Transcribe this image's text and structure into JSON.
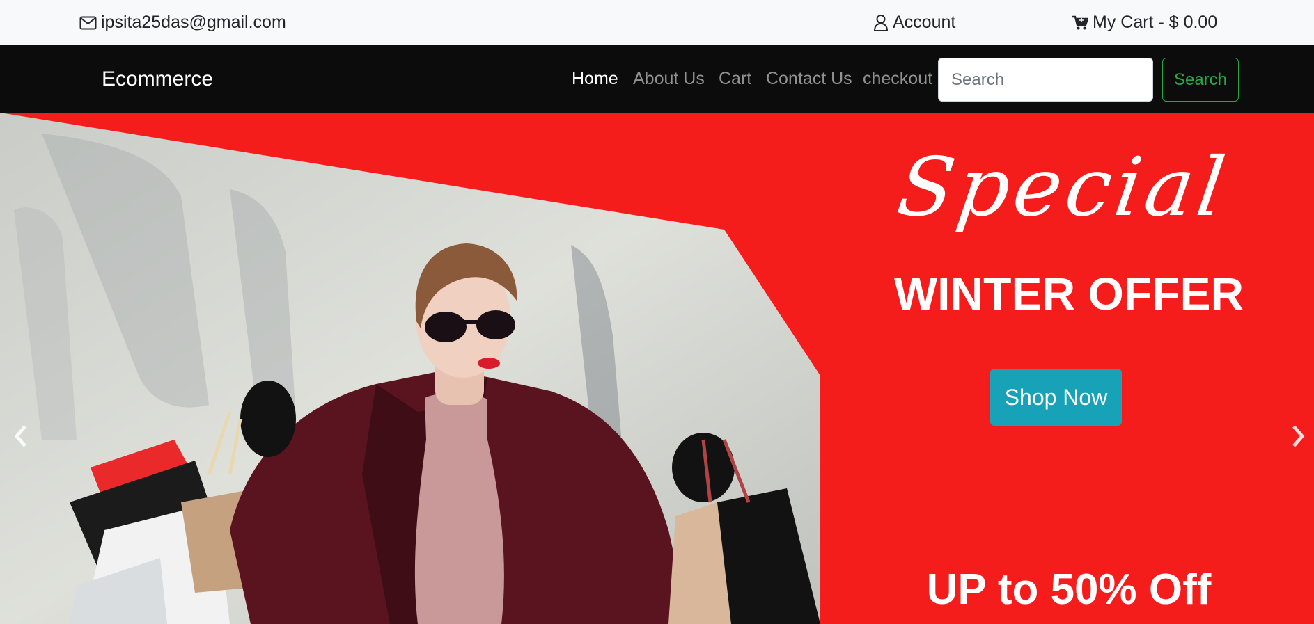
{
  "topbar": {
    "email": "ipsita25das@gmail.com",
    "account_label": "Account",
    "cart_label": "My Cart - $ 0.00",
    "icons": [
      "envelope-icon",
      "user-icon",
      "cart-icon"
    ]
  },
  "navbar": {
    "brand": "Ecommerce",
    "links": [
      {
        "label": "Home",
        "active": true
      },
      {
        "label": "About Us",
        "active": false
      },
      {
        "label": "Cart",
        "active": false
      },
      {
        "label": "Contact Us",
        "active": false
      },
      {
        "label": "checkout",
        "active": false
      }
    ],
    "search": {
      "placeholder": "Search",
      "value": "",
      "button_label": "Search"
    }
  },
  "hero": {
    "special": "Special",
    "headline": "WINTER OFFER",
    "cta_label": "Shop Now",
    "offer": "UP to 50% Off",
    "prev_icon": "chevron-left-icon",
    "next_icon": "chevron-right-icon"
  },
  "colors": {
    "topbar_bg": "#f8f9fa",
    "navbar_bg": "#0c0c0c",
    "hero_bg": "#f51c1c",
    "search_button": "#28a745",
    "cta_bg": "#17a2b8"
  }
}
